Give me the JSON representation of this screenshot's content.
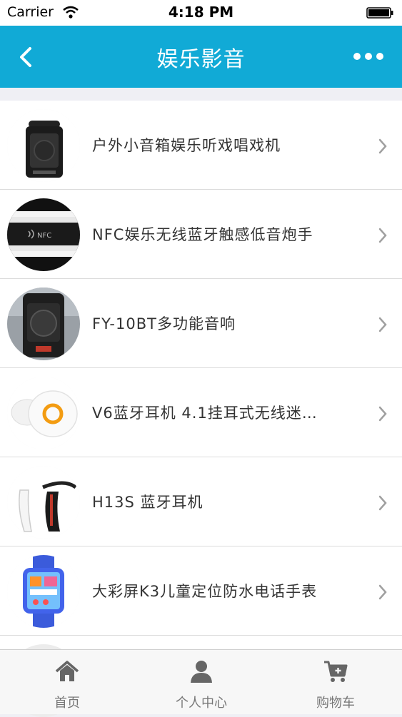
{
  "status_bar": {
    "carrier": "Carrier",
    "time": "4:18 PM"
  },
  "nav": {
    "title": "娱乐影音",
    "back_icon": "chevron-left-icon",
    "more_icon": "more-dots-icon"
  },
  "products": [
    {
      "name": "户外小音箱娱乐听戏唱戏机",
      "image": "portable-speaker"
    },
    {
      "name": "NFC娱乐无线蓝牙触感低音炮手",
      "image": "nfc-speaker"
    },
    {
      "name": "FY-10BT多功能音响",
      "image": "pa-speaker"
    },
    {
      "name": "V6蓝牙耳机 4.1挂耳式无线迷…",
      "image": "earbud"
    },
    {
      "name": "H13S 蓝牙耳机",
      "image": "bluetooth-headset"
    },
    {
      "name": "大彩屏K3儿童定位防水电话手表",
      "image": "kids-watch"
    }
  ],
  "tabs": [
    {
      "label": "首页",
      "icon": "home-icon"
    },
    {
      "label": "个人中心",
      "icon": "user-icon"
    },
    {
      "label": "购物车",
      "icon": "cart-icon"
    }
  ],
  "colors": {
    "accent": "#11aad6",
    "background": "#efeff4"
  }
}
